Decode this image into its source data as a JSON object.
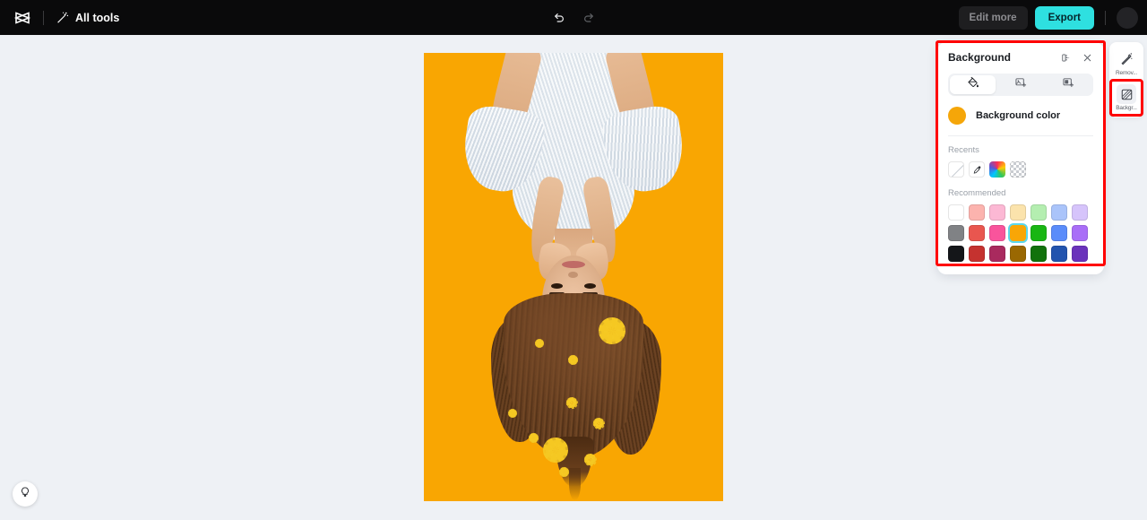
{
  "topbar": {
    "logo_icon": "capcut-logo-icon",
    "all_tools_icon": "magic-wand-icon",
    "all_tools_label": "All tools",
    "undo_icon": "undo-arrow-icon",
    "redo_icon": "redo-arrow-icon",
    "edit_more_label": "Edit more",
    "export_label": "Export",
    "avatar_label": ""
  },
  "canvas": {
    "artboard_background_color": "#f9a602",
    "workspace_background_color": "#eef1f5",
    "image_description": "Upside-down portrait of a woman in a white lace dress with long brown hair full of yellow daisies"
  },
  "help": {
    "icon": "lightbulb-icon"
  },
  "right_rail": {
    "items": [
      {
        "icon": "remove-background-eraser-icon",
        "label": "Remov...",
        "active": false
      },
      {
        "icon": "background-checkered-icon",
        "label": "Backgr...",
        "active": true
      }
    ]
  },
  "background_panel": {
    "title": "Background",
    "compare_icon": "compare-split-icon",
    "close_icon": "close-x-icon",
    "tabs": [
      {
        "icon": "paint-bucket-icon",
        "name": "fill-color",
        "active": true
      },
      {
        "icon": "image-add-icon",
        "name": "image-background",
        "active": false
      },
      {
        "icon": "blur-add-icon",
        "name": "blur-background",
        "active": false
      }
    ],
    "background_color": {
      "label": "Background color",
      "value": "#f5a609"
    },
    "recents": {
      "label": "Recents",
      "items": [
        {
          "name": "no-color-swatch",
          "type": "none"
        },
        {
          "name": "eyedropper-swatch",
          "type": "picker"
        },
        {
          "name": "gradient-swatch",
          "type": "gradient"
        },
        {
          "name": "transparent-swatch",
          "type": "transparent"
        }
      ]
    },
    "recommended": {
      "label": "Recommended",
      "rows": [
        [
          {
            "color": "#ffffff",
            "selected": false
          },
          {
            "color": "#fcb3ae",
            "selected": false
          },
          {
            "color": "#fcb8d4",
            "selected": false
          },
          {
            "color": "#fbe3ac",
            "selected": false
          },
          {
            "color": "#b4eeb0",
            "selected": false
          },
          {
            "color": "#aac4fa",
            "selected": false
          },
          {
            "color": "#d6c4fb",
            "selected": false
          }
        ],
        [
          {
            "color": "#808285",
            "selected": false
          },
          {
            "color": "#e9564f",
            "selected": false
          },
          {
            "color": "#f9549c",
            "selected": false
          },
          {
            "color": "#f9a606",
            "selected": true
          },
          {
            "color": "#19b613",
            "selected": false
          },
          {
            "color": "#5a8cfa",
            "selected": false
          },
          {
            "color": "#a96ef7",
            "selected": false
          }
        ],
        [
          {
            "color": "#141619",
            "selected": false
          },
          {
            "color": "#c5322f",
            "selected": false
          },
          {
            "color": "#a92a5e",
            "selected": false
          },
          {
            "color": "#9a6802",
            "selected": false
          },
          {
            "color": "#12720c",
            "selected": false
          },
          {
            "color": "#2254ae",
            "selected": false
          },
          {
            "color": "#6a33bb",
            "selected": false
          }
        ]
      ]
    }
  },
  "highlights": {
    "panel_border_color": "#ff0000",
    "rail_border_color": "#ff0000"
  }
}
